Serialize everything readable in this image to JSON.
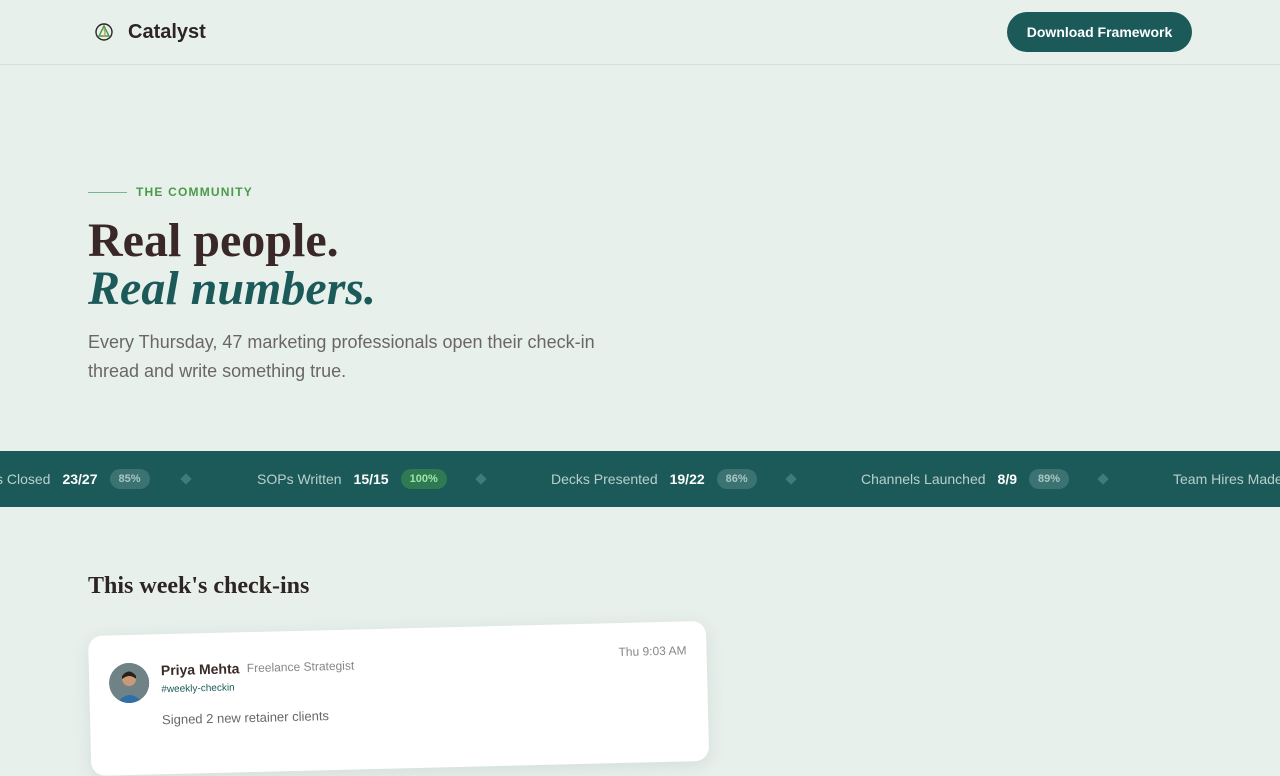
{
  "nav": {
    "brand_name": "Catalyst",
    "cta_label": "Download Framework"
  },
  "hero": {
    "eyebrow": "THE COMMUNITY",
    "headline_line1": "Real people.",
    "headline_line2": "Real numbers.",
    "lede": "Every Thursday, 47 marketing professionals open their check-in thread and write something true."
  },
  "ticker": {
    "items": [
      {
        "label": "s Closed",
        "value": "23/27",
        "badge": "85%"
      },
      {
        "label": "SOPs Written",
        "value": "15/15",
        "badge": "100%"
      },
      {
        "label": "Decks Presented",
        "value": "19/22",
        "badge": "86%"
      },
      {
        "label": "Channels Launched",
        "value": "8/9",
        "badge": "89%"
      },
      {
        "label": "Team Hires Made",
        "value": "",
        "badge": ""
      }
    ]
  },
  "checkins": {
    "title": "This week's check-ins",
    "cards": [
      {
        "name": "Priya Mehta",
        "role": "Freelance Strategist",
        "tag": "#weekly-checkin",
        "time": "Thu 9:03 AM",
        "body": "Signed 2 new retainer clients"
      }
    ]
  },
  "colors": {
    "accent": "#1c5a5a",
    "eyebrow": "#4a9a4a",
    "background": "#e8f0ec"
  }
}
